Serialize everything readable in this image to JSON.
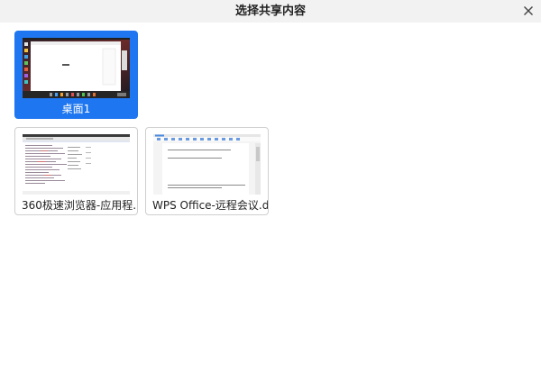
{
  "dialog": {
    "title": "选择共享内容",
    "close_icon": "close-icon"
  },
  "sources": [
    {
      "label": "桌面1",
      "selected": true,
      "thumbnail": "desktop-screen-thumbnail"
    },
    {
      "label": "360极速浏览器-应用程...",
      "selected": false,
      "thumbnail": "browser-window-thumbnail"
    },
    {
      "label": "WPS Office-远程会议.d...",
      "selected": false,
      "thumbnail": "wps-document-thumbnail"
    }
  ],
  "colors": {
    "accent": "#1e76f0",
    "titlebar": "#f2f2f2",
    "card_border": "#cfcfcf"
  }
}
